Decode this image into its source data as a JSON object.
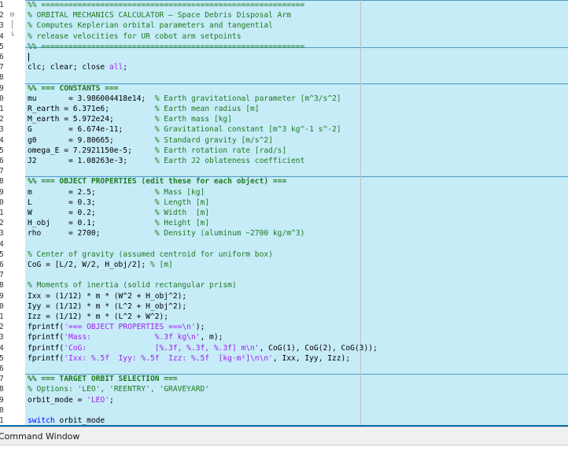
{
  "editor": {
    "cell_color": "#c6ecf8",
    "cell_divider_color": "#4a9bc4",
    "lines": [
      {
        "n": "1",
        "fold": "",
        "tokens": [
          {
            "t": "%% ==========================================================",
            "c": "comment"
          }
        ]
      },
      {
        "n": "2",
        "fold": "⊟",
        "tokens": [
          {
            "t": "% ORBITAL MECHANICS CALCULATOR — Space Debris Disposal Arm",
            "c": "comment"
          }
        ]
      },
      {
        "n": "3",
        "fold": "│",
        "tokens": [
          {
            "t": "% Computes Keplerian orbital parameters and tangential",
            "c": "comment"
          }
        ]
      },
      {
        "n": "4",
        "fold": "└",
        "tokens": [
          {
            "t": "% release velocities for UR cobot arm setpoints",
            "c": "comment"
          }
        ]
      },
      {
        "n": "5",
        "fold": "",
        "tokens": [
          {
            "t": "%% ==========================================================",
            "c": "comment"
          }
        ]
      },
      {
        "n": "6",
        "fold": "",
        "tokens": []
      },
      {
        "n": "7",
        "fold": "",
        "tokens": [
          {
            "t": "clc; clear; close ",
            "c": "plain"
          },
          {
            "t": "all",
            "c": "string"
          },
          {
            "t": ";",
            "c": "plain"
          }
        ]
      },
      {
        "n": "8",
        "fold": "",
        "tokens": []
      },
      {
        "n": "9",
        "fold": "",
        "tokens": [
          {
            "t": "%% === CONSTANTS ===",
            "c": "comment",
            "b": true
          }
        ]
      },
      {
        "n": "0",
        "fold": "",
        "tokens": [
          {
            "t": "mu       = 3.986004418e14;  ",
            "c": "plain"
          },
          {
            "t": "% Earth gravitational parameter [m^3/s^2]",
            "c": "comment"
          }
        ]
      },
      {
        "n": "1",
        "fold": "",
        "tokens": [
          {
            "t": "R_earth = 6.371e6;          ",
            "c": "plain"
          },
          {
            "t": "% Earth mean radius [m]",
            "c": "comment"
          }
        ]
      },
      {
        "n": "2",
        "fold": "",
        "tokens": [
          {
            "t": "M_earth = 5.972e24;         ",
            "c": "plain"
          },
          {
            "t": "% Earth mass [kg]",
            "c": "comment"
          }
        ]
      },
      {
        "n": "3",
        "fold": "",
        "tokens": [
          {
            "t": "G        = 6.674e-11;       ",
            "c": "plain"
          },
          {
            "t": "% Gravitational constant [m^3 kg^-1 s^-2]",
            "c": "comment"
          }
        ]
      },
      {
        "n": "4",
        "fold": "",
        "tokens": [
          {
            "t": "g0       = 9.80665;         ",
            "c": "plain"
          },
          {
            "t": "% Standard gravity [m/s^2]",
            "c": "comment"
          }
        ]
      },
      {
        "n": "5",
        "fold": "",
        "tokens": [
          {
            "t": "omega_E = 7.2921150e-5;     ",
            "c": "plain"
          },
          {
            "t": "% Earth rotation rate [rad/s]",
            "c": "comment"
          }
        ]
      },
      {
        "n": "6",
        "fold": "",
        "tokens": [
          {
            "t": "J2       = 1.08263e-3;      ",
            "c": "plain"
          },
          {
            "t": "% Earth J2 oblateness coefficient",
            "c": "comment"
          }
        ]
      },
      {
        "n": "7",
        "fold": "",
        "tokens": []
      },
      {
        "n": "8",
        "fold": "",
        "tokens": [
          {
            "t": "%% === OBJECT PROPERTIES (edit these for each object) ===",
            "c": "comment",
            "b": true
          }
        ]
      },
      {
        "n": "9",
        "fold": "",
        "tokens": [
          {
            "t": "m        = 2.5;             ",
            "c": "plain"
          },
          {
            "t": "% Mass [kg]",
            "c": "comment"
          }
        ]
      },
      {
        "n": "0",
        "fold": "",
        "tokens": [
          {
            "t": "L        = 0.3;             ",
            "c": "plain"
          },
          {
            "t": "% Length [m]",
            "c": "comment"
          }
        ]
      },
      {
        "n": "1",
        "fold": "",
        "tokens": [
          {
            "t": "W        = 0.2;             ",
            "c": "plain"
          },
          {
            "t": "% Width  [m]",
            "c": "comment"
          }
        ]
      },
      {
        "n": "2",
        "fold": "",
        "tokens": [
          {
            "t": "H_obj    = 0.1;             ",
            "c": "plain"
          },
          {
            "t": "% Height [m]",
            "c": "comment"
          }
        ]
      },
      {
        "n": "3",
        "fold": "",
        "tokens": [
          {
            "t": "rho      = 2700;            ",
            "c": "plain"
          },
          {
            "t": "% Density (aluminum ~2700 kg/m^3)",
            "c": "comment"
          }
        ]
      },
      {
        "n": "4",
        "fold": "",
        "tokens": []
      },
      {
        "n": "5",
        "fold": "",
        "tokens": [
          {
            "t": "% Center of gravity (assumed centroid for uniform box)",
            "c": "comment"
          }
        ]
      },
      {
        "n": "6",
        "fold": "",
        "tokens": [
          {
            "t": "CoG = [L/2, W/2, H_obj/2]; ",
            "c": "plain"
          },
          {
            "t": "% [m]",
            "c": "comment"
          }
        ]
      },
      {
        "n": "7",
        "fold": "",
        "tokens": []
      },
      {
        "n": "8",
        "fold": "",
        "tokens": [
          {
            "t": "% Moments of inertia (solid rectangular prism)",
            "c": "comment"
          }
        ]
      },
      {
        "n": "9",
        "fold": "",
        "tokens": [
          {
            "t": "Ixx = (1/12) * m * (W^2 + H_obj^2);",
            "c": "plain"
          }
        ]
      },
      {
        "n": "0",
        "fold": "",
        "tokens": [
          {
            "t": "Iyy = (1/12) * m * (L^2 + H_obj^2);",
            "c": "plain"
          }
        ]
      },
      {
        "n": "1",
        "fold": "",
        "tokens": [
          {
            "t": "Izz = (1/12) * m * (L^2 + W^2);",
            "c": "plain"
          }
        ]
      },
      {
        "n": "2",
        "fold": "",
        "tokens": [
          {
            "t": "fprintf(",
            "c": "plain"
          },
          {
            "t": "'=== OBJECT PROPERTIES ===\\n'",
            "c": "string"
          },
          {
            "t": ");",
            "c": "plain"
          }
        ]
      },
      {
        "n": "3",
        "fold": "",
        "tokens": [
          {
            "t": "fprintf(",
            "c": "plain"
          },
          {
            "t": "'Mass:              %.3f kg\\n'",
            "c": "string"
          },
          {
            "t": ", m);",
            "c": "plain"
          }
        ]
      },
      {
        "n": "4",
        "fold": "",
        "tokens": [
          {
            "t": "fprintf(",
            "c": "plain"
          },
          {
            "t": "'CoG:               [%.3f, %.3f, %.3f] m\\n'",
            "c": "string"
          },
          {
            "t": ", CoG(1), CoG(2), CoG(3));",
            "c": "plain"
          }
        ]
      },
      {
        "n": "5",
        "fold": "",
        "tokens": [
          {
            "t": "fprintf(",
            "c": "plain"
          },
          {
            "t": "'Ixx: %.5f  Iyy: %.5f  Izz: %.5f  [kg·m²]\\n\\n'",
            "c": "string"
          },
          {
            "t": ", Ixx, Iyy, Izz);",
            "c": "plain"
          }
        ]
      },
      {
        "n": "6",
        "fold": "",
        "tokens": []
      },
      {
        "n": "7",
        "fold": "",
        "tokens": [
          {
            "t": "%% === TARGET ORBIT SELECTION ===",
            "c": "comment",
            "b": true
          }
        ]
      },
      {
        "n": "8",
        "fold": "",
        "tokens": [
          {
            "t": "% Options: 'LEO', 'REENTRY', 'GRAVEYARD'",
            "c": "comment"
          }
        ]
      },
      {
        "n": "9",
        "fold": "",
        "tokens": [
          {
            "t": "orbit_mode = ",
            "c": "plain"
          },
          {
            "t": "'LEO'",
            "c": "string"
          },
          {
            "t": ";",
            "c": "plain"
          }
        ]
      },
      {
        "n": "0",
        "fold": "",
        "tokens": []
      },
      {
        "n": "1",
        "fold": "",
        "tokens": [
          {
            "t": "switch",
            "c": "keyword"
          },
          {
            "t": " orbit_mode",
            "c": "plain"
          }
        ]
      }
    ]
  },
  "command_window": {
    "title": "Command Window"
  }
}
